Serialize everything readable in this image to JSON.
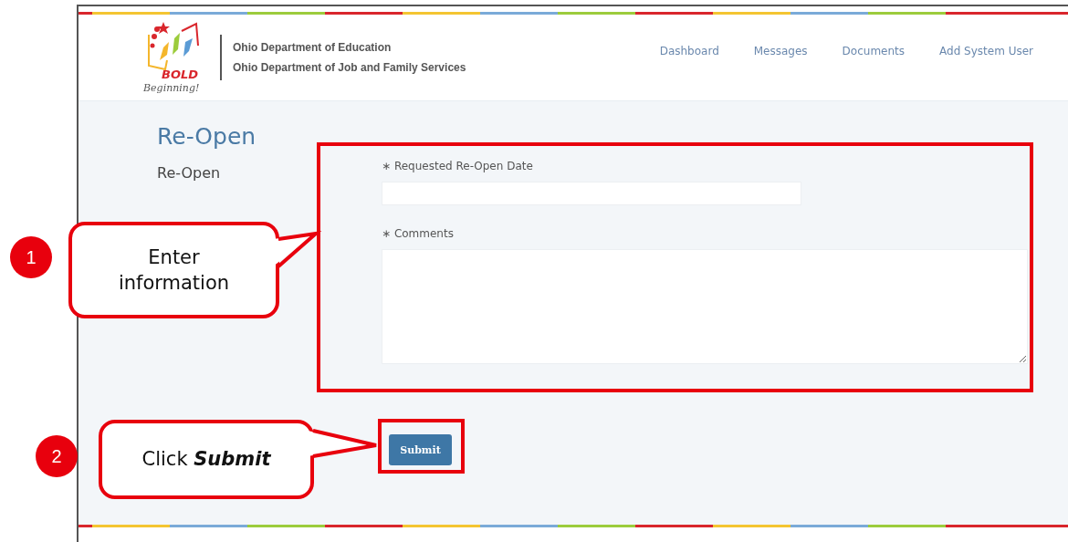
{
  "header": {
    "logo": {
      "word": "BOLD",
      "tagline": "Beginning!"
    },
    "org_lines": [
      "Ohio Department of Education",
      "Ohio Department of Job and Family Services"
    ],
    "nav": [
      "Dashboard",
      "Messages",
      "Documents",
      "Add System User"
    ]
  },
  "page": {
    "title": "Re-Open",
    "subtitle": "Re-Open"
  },
  "form": {
    "fields": [
      {
        "kind": "input",
        "label": "Requested Re-Open Date",
        "required_mark": "∗"
      },
      {
        "kind": "textarea",
        "label": "Comments",
        "required_mark": "∗"
      }
    ],
    "submit": "Submit"
  },
  "annotations": [
    {
      "number": "1",
      "text": "Enter information"
    },
    {
      "number": "2",
      "text": "Click *Submit*"
    }
  ]
}
